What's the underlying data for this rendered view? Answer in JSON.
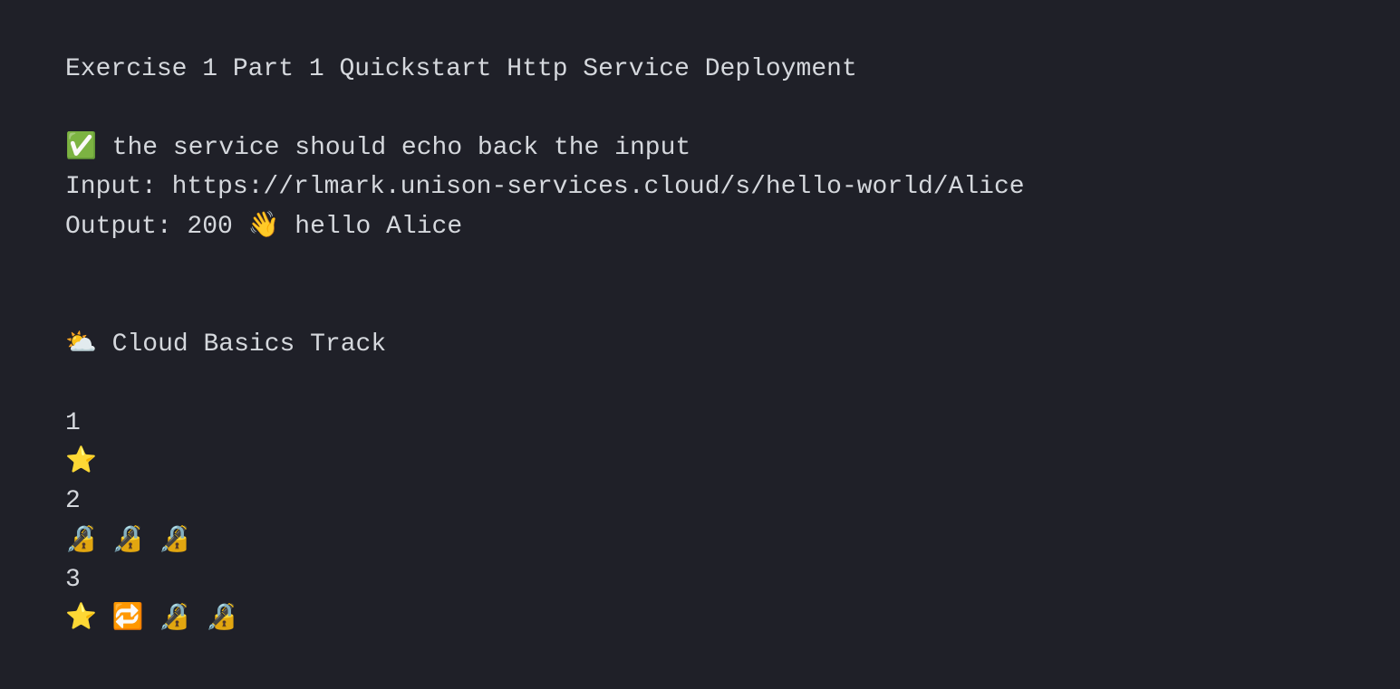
{
  "terminal": {
    "lines": [
      "Exercise 1 Part 1 Quickstart Http Service Deployment",
      "",
      "✅ the service should echo back the input",
      "Input: https://rlmark.unison-services.cloud/s/hello-world/Alice",
      "Output: 200 👋 hello Alice",
      "",
      "",
      "⛅ Cloud Basics Track",
      "",
      "1",
      "⭐",
      "2",
      "🔏 🔏 🔏",
      "3",
      "⭐ 🔁 🔏 🔏"
    ]
  }
}
